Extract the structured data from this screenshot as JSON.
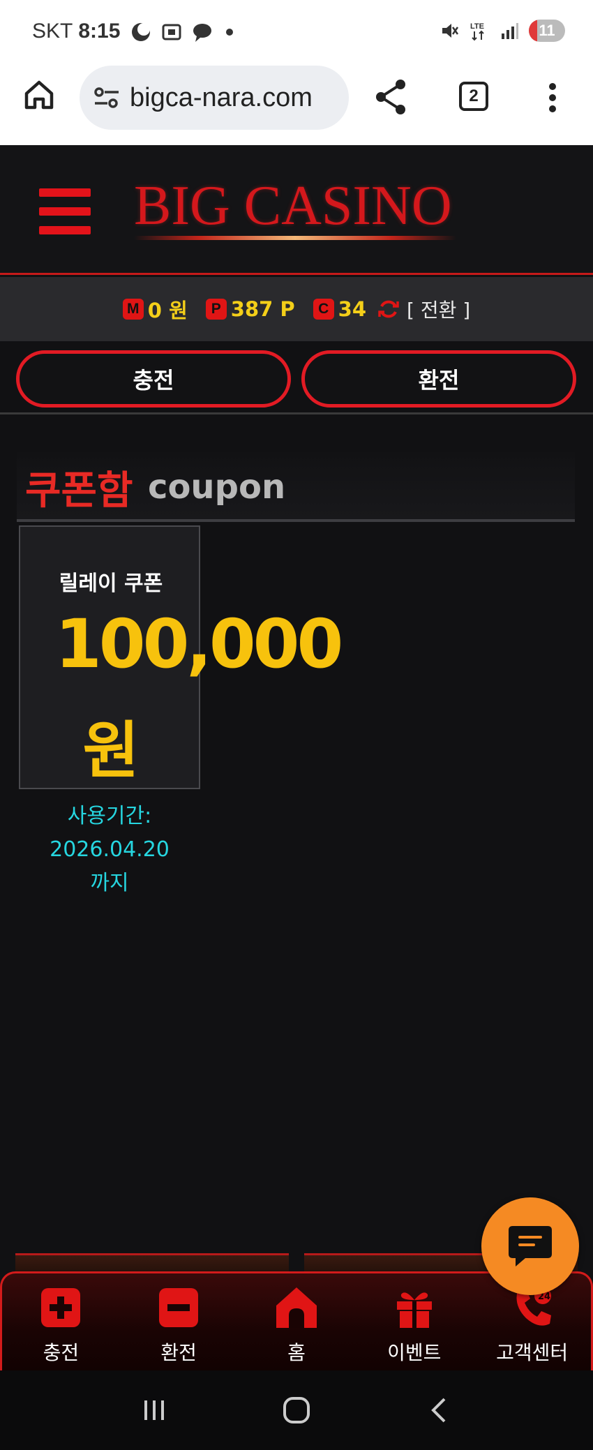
{
  "status_bar": {
    "carrier": "SKT",
    "time": "8:15",
    "battery": "11"
  },
  "browser": {
    "url": "bigca-nara.com",
    "tab_count": "2"
  },
  "header": {
    "logo": "BIG CASINO"
  },
  "balance": {
    "money_badge": "M",
    "money": "0 원",
    "point_badge": "P",
    "points": "387 P",
    "coupon_badge": "C",
    "coupons": "34",
    "switch_label": "[ 전환 ]"
  },
  "actions": {
    "charge": "충전",
    "exchange": "환전"
  },
  "coupon_section": {
    "title_kr": "쿠폰함",
    "title_en": "coupon",
    "card": {
      "name": "릴레이 쿠폰",
      "amount": "100,000",
      "unit": "원",
      "expiry_label": "사용기간:",
      "expiry_date": "2026.04.20",
      "expiry_suffix": "까지"
    }
  },
  "bottom_nav": [
    {
      "label": "충전",
      "icon": "plus-icon"
    },
    {
      "label": "환전",
      "icon": "minus-icon"
    },
    {
      "label": "홈",
      "icon": "home-icon"
    },
    {
      "label": "이벤트",
      "icon": "gift-icon"
    },
    {
      "label": "고객센터",
      "icon": "phone-24-icon"
    }
  ],
  "colors": {
    "accent_red": "#e21b24",
    "gold": "#f7c20d",
    "cyan": "#26d6e0",
    "chat_orange": "#f58a23"
  }
}
